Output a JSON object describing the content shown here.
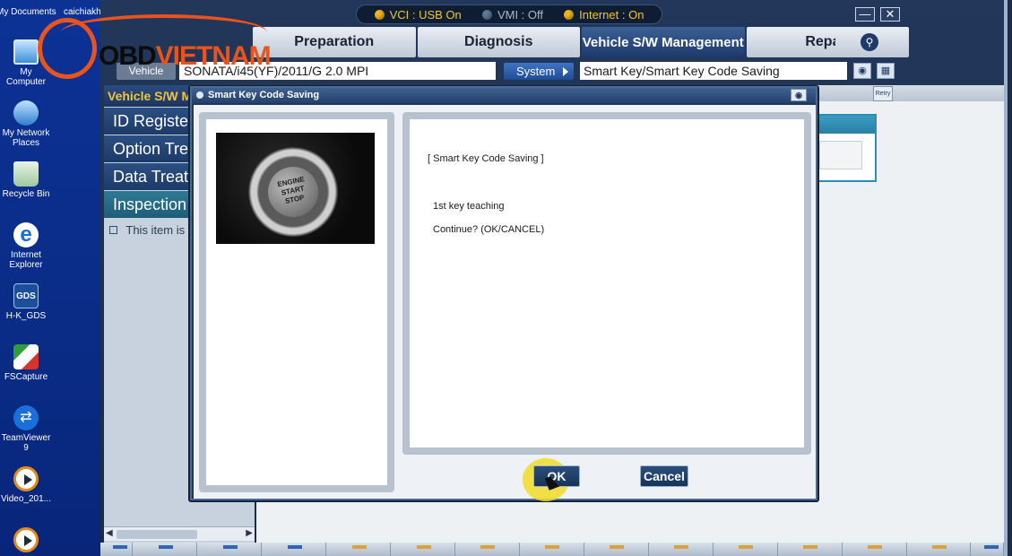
{
  "desktop": {
    "top_labels": [
      "My Documents",
      "caichiakh"
    ],
    "icons": [
      {
        "label": "My Computer",
        "icon": "computer-icon"
      },
      {
        "label": "My Network Places",
        "icon": "network-icon"
      },
      {
        "label": "Recycle Bin",
        "icon": "recycle-bin-icon"
      },
      {
        "label": "Internet Explorer",
        "icon": "internet-explorer-icon"
      },
      {
        "label": "H-K_GDS",
        "icon": "gds-icon",
        "glyph": "GDS"
      },
      {
        "label": "FSCapture",
        "icon": "fscapture-icon"
      },
      {
        "label": "TeamViewer 9",
        "icon": "teamviewer-icon"
      },
      {
        "label": "Video_201...",
        "icon": "video-icon"
      },
      {
        "label": "",
        "icon": "video-icon"
      }
    ]
  },
  "status": {
    "vci": "VCI : USB On",
    "vmi": "VMI : Off",
    "internet": "Internet : On"
  },
  "window_controls": {
    "minimize": "—",
    "close": "✕"
  },
  "tabs": [
    {
      "label": "Preparation",
      "active": false
    },
    {
      "label": "Diagnosis",
      "active": false
    },
    {
      "label": "Vehicle S/W Management",
      "active": true
    },
    {
      "label": "Repair",
      "active": false
    }
  ],
  "search_icon": "search-icon",
  "info": {
    "vehicle_label": "Vehicle",
    "vehicle_value": "SONATA/i45(YF)/2011/G 2.0 MPI",
    "system_label": "System",
    "system_value": "Smart Key/Smart Key Code Saving"
  },
  "left_panel": {
    "title": "Vehicle S/W M",
    "items": [
      "ID Registe",
      "Option Treat",
      "Data Treatr",
      "Inspection /"
    ],
    "selected_index": 3,
    "note": "This item is r"
  },
  "right_panel": {
    "retry_label": "Retry"
  },
  "logo": {
    "text_prefix": "OBD",
    "text_suffix": "VIETNAM"
  },
  "dialog": {
    "title": "Smart Key Code Saving",
    "image_text": [
      "ENGINE",
      "START",
      "STOP"
    ],
    "message_title": "[ Smart Key Code Saving ]",
    "message_line1": "1st key teaching",
    "message_line2": "Continue? (OK/CANCEL)",
    "ok_label": "OK",
    "cancel_label": "Cancel"
  },
  "colors": {
    "desktop_bg": "#0a2c86",
    "accent_yellow": "#f2c43a",
    "tab_active": "#1e3a6b",
    "logo_orange": "#e8541c"
  }
}
